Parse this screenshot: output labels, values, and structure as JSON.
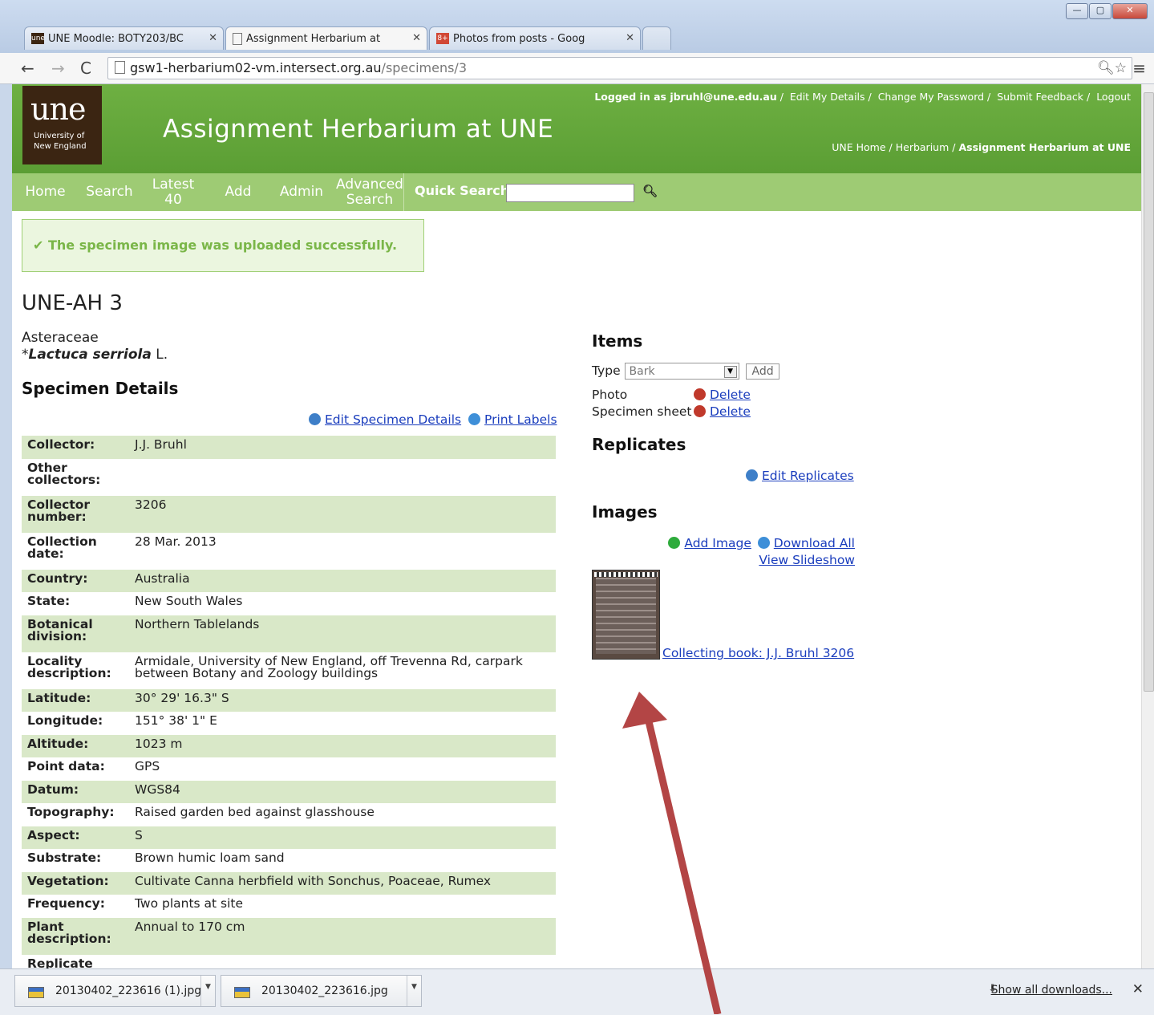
{
  "browser": {
    "tabs": [
      {
        "label": "UNE Moodle: BOTY203/BC",
        "favicon": "une"
      },
      {
        "label": "Assignment Herbarium at",
        "favicon": "page"
      },
      {
        "label": "Photos from posts - Goog",
        "favicon": "g+"
      }
    ],
    "url_host": "gsw1-herbarium02-vm.intersect.org.au",
    "url_path": "/specimens/3"
  },
  "header": {
    "logo_text": "une",
    "logo_sub1": "University of",
    "logo_sub2": "New England",
    "site_title": "Assignment Herbarium at UNE",
    "logged_in": "Logged in as jbruhl@une.edu.au",
    "user_links": [
      "Edit My Details",
      "Change My Password",
      "Submit Feedback",
      "Logout"
    ],
    "breadcrumbs": [
      "UNE Home",
      "Herbarium",
      "Assignment Herbarium at UNE"
    ]
  },
  "nav": {
    "home": "Home",
    "search": "Search",
    "latest1": "Latest",
    "latest2": "40",
    "add": "Add",
    "admin": "Admin",
    "adv1": "Advanced",
    "adv2": "Search",
    "quick_search": "Quick Search"
  },
  "flash": "✔ The specimen image was uploaded successfully.",
  "specimen": {
    "id": "UNE-AH 3",
    "family": "Asteraceae",
    "taxon_prefix": "*",
    "taxon_name": "Lactuca serriola",
    "taxon_author": " L."
  },
  "details": {
    "heading": "Specimen Details",
    "edit_link": "Edit Specimen Details",
    "print_link": "Print Labels",
    "rows": [
      {
        "k": "Collector:",
        "v": "J.J. Bruhl"
      },
      {
        "k": "Other collectors:",
        "v": ""
      },
      {
        "k": "Collector number:",
        "v": "3206"
      },
      {
        "k": "Collection date:",
        "v": "28 Mar. 2013"
      },
      {
        "k": "Country:",
        "v": "Australia"
      },
      {
        "k": "State:",
        "v": "New South Wales"
      },
      {
        "k": "Botanical division:",
        "v": "Northern Tablelands"
      },
      {
        "k": "Locality description:",
        "v": "Armidale, University of New England, off Trevenna Rd, carpark between Botany and Zoology buildings"
      },
      {
        "k": "Latitude:",
        "v": "30° 29' 16.3\" S"
      },
      {
        "k": "Longitude:",
        "v": "151° 38' 1\" E"
      },
      {
        "k": "Altitude:",
        "v": "1023 m"
      },
      {
        "k": "Point data:",
        "v": "GPS"
      },
      {
        "k": "Datum:",
        "v": "WGS84"
      },
      {
        "k": "Topography:",
        "v": "Raised garden bed against glasshouse"
      },
      {
        "k": "Aspect:",
        "v": "S"
      },
      {
        "k": "Substrate:",
        "v": "Brown humic loam sand"
      },
      {
        "k": "Vegetation:",
        "v": "Cultivate Canna herbfield with Sonchus, Poaceae, Rumex"
      },
      {
        "k": "Frequency:",
        "v": "Two plants at site"
      },
      {
        "k": "Plant description:",
        "v": "Annual to 170 cm"
      },
      {
        "k": "Replicate From:",
        "v": ""
      }
    ]
  },
  "items": {
    "heading": "Items",
    "type_label": "Type",
    "type_value": "Bark",
    "add_label": "Add",
    "list": [
      {
        "name": "Photo",
        "action": "Delete"
      },
      {
        "name": "Specimen sheet",
        "action": "Delete"
      }
    ]
  },
  "replicates": {
    "heading": "Replicates",
    "edit_link": "Edit Replicates"
  },
  "images": {
    "heading": "Images",
    "add_link": "Add Image",
    "download_link": "Download All",
    "slideshow_link": "View Slideshow",
    "caption": "Collecting book: J.J. Bruhl 3206"
  },
  "downloads": {
    "files": [
      "20130402_223616 (1).jpg",
      "20130402_223616.jpg"
    ],
    "show_all": "Show all downloads..."
  },
  "colors": {
    "header_green": "#5b9e34",
    "nav_green": "#9ecb74",
    "row_alt": "#d9e8c8",
    "link": "#1a3dbd",
    "arrow": "#b34545"
  }
}
